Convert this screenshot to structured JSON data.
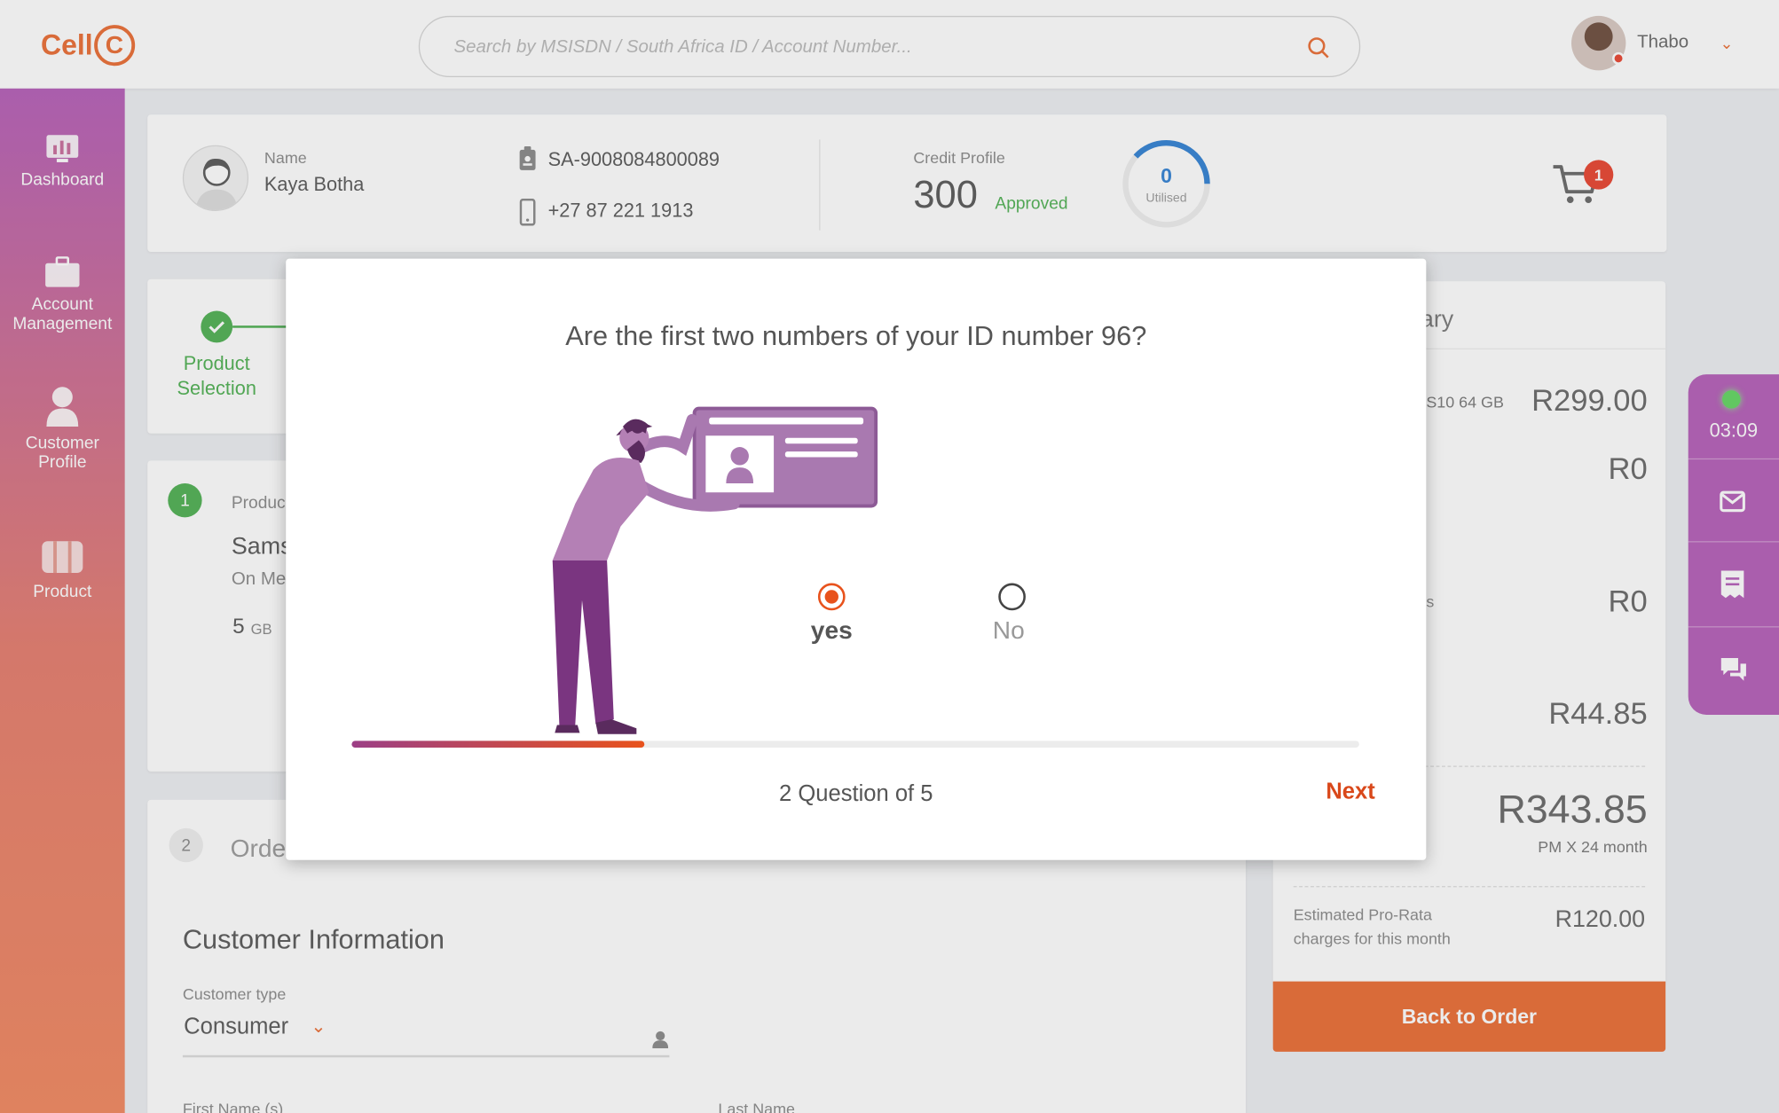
{
  "brand": {
    "logo_text": "Cell",
    "logo_letter": "C"
  },
  "search": {
    "placeholder": "Search by MSISDN / South Africa ID / Account Number..."
  },
  "user": {
    "name": "Thabo"
  },
  "sidebar": {
    "items": [
      {
        "label": "Dashboard",
        "icon": "chart-icon"
      },
      {
        "label": "Account Management",
        "icon": "briefcase-icon"
      },
      {
        "label": "Customer Profile",
        "icon": "person-icon"
      },
      {
        "label": "Product",
        "icon": "box-icon"
      }
    ]
  },
  "profile": {
    "name_label": "Name",
    "name": "Kaya Botha",
    "id_number": "SA-9008084800089",
    "phone": "+27 87 221 1913",
    "credit_label": "Credit Profile",
    "credit_score": "300",
    "credit_status": "Approved",
    "utilised_value": "0",
    "utilised_label": "Utilised",
    "cart_count": "1"
  },
  "steps": {
    "step1_label": "Product Selection"
  },
  "product": {
    "number": "1",
    "label": "Produc",
    "name": "Sams",
    "sub": "On Me",
    "data_amount": "5",
    "data_unit": "GB"
  },
  "order": {
    "number": "2",
    "title": "Orde",
    "section_title": "Customer Information",
    "customer_type_label": "Customer type",
    "customer_type_value": "Consumer",
    "first_name_label": "First Name (s)",
    "last_name_label": "Last Name"
  },
  "summary": {
    "title": "ary",
    "item_name": "S10 64 GB",
    "item_price": "R299.00",
    "row2_value": "R0",
    "row3_label": "s",
    "row3_value": "R0",
    "row4_value": "R44.85",
    "total": "R343.85",
    "total_sub": "PM X 24 month",
    "prorata_label_1": "Estimated Pro-Rata",
    "prorata_label_2": "charges for this month",
    "prorata_value": "R120.00",
    "back_button": "Back to Order"
  },
  "rail": {
    "timer": "03:09",
    "status_color": "#5fd65f"
  },
  "modal": {
    "question": "Are the first two numbers of your ID number 96?",
    "options": [
      {
        "label": "yes",
        "selected": true
      },
      {
        "label": "No",
        "selected": false
      }
    ],
    "progress_fraction": 0.29,
    "question_counter": "2 Question of 5",
    "next_label": "Next"
  },
  "colors": {
    "accent": "#ea6a30",
    "sidebar_top": "#b45bb7",
    "success": "#4caf50",
    "link": "#2e7fd3"
  }
}
